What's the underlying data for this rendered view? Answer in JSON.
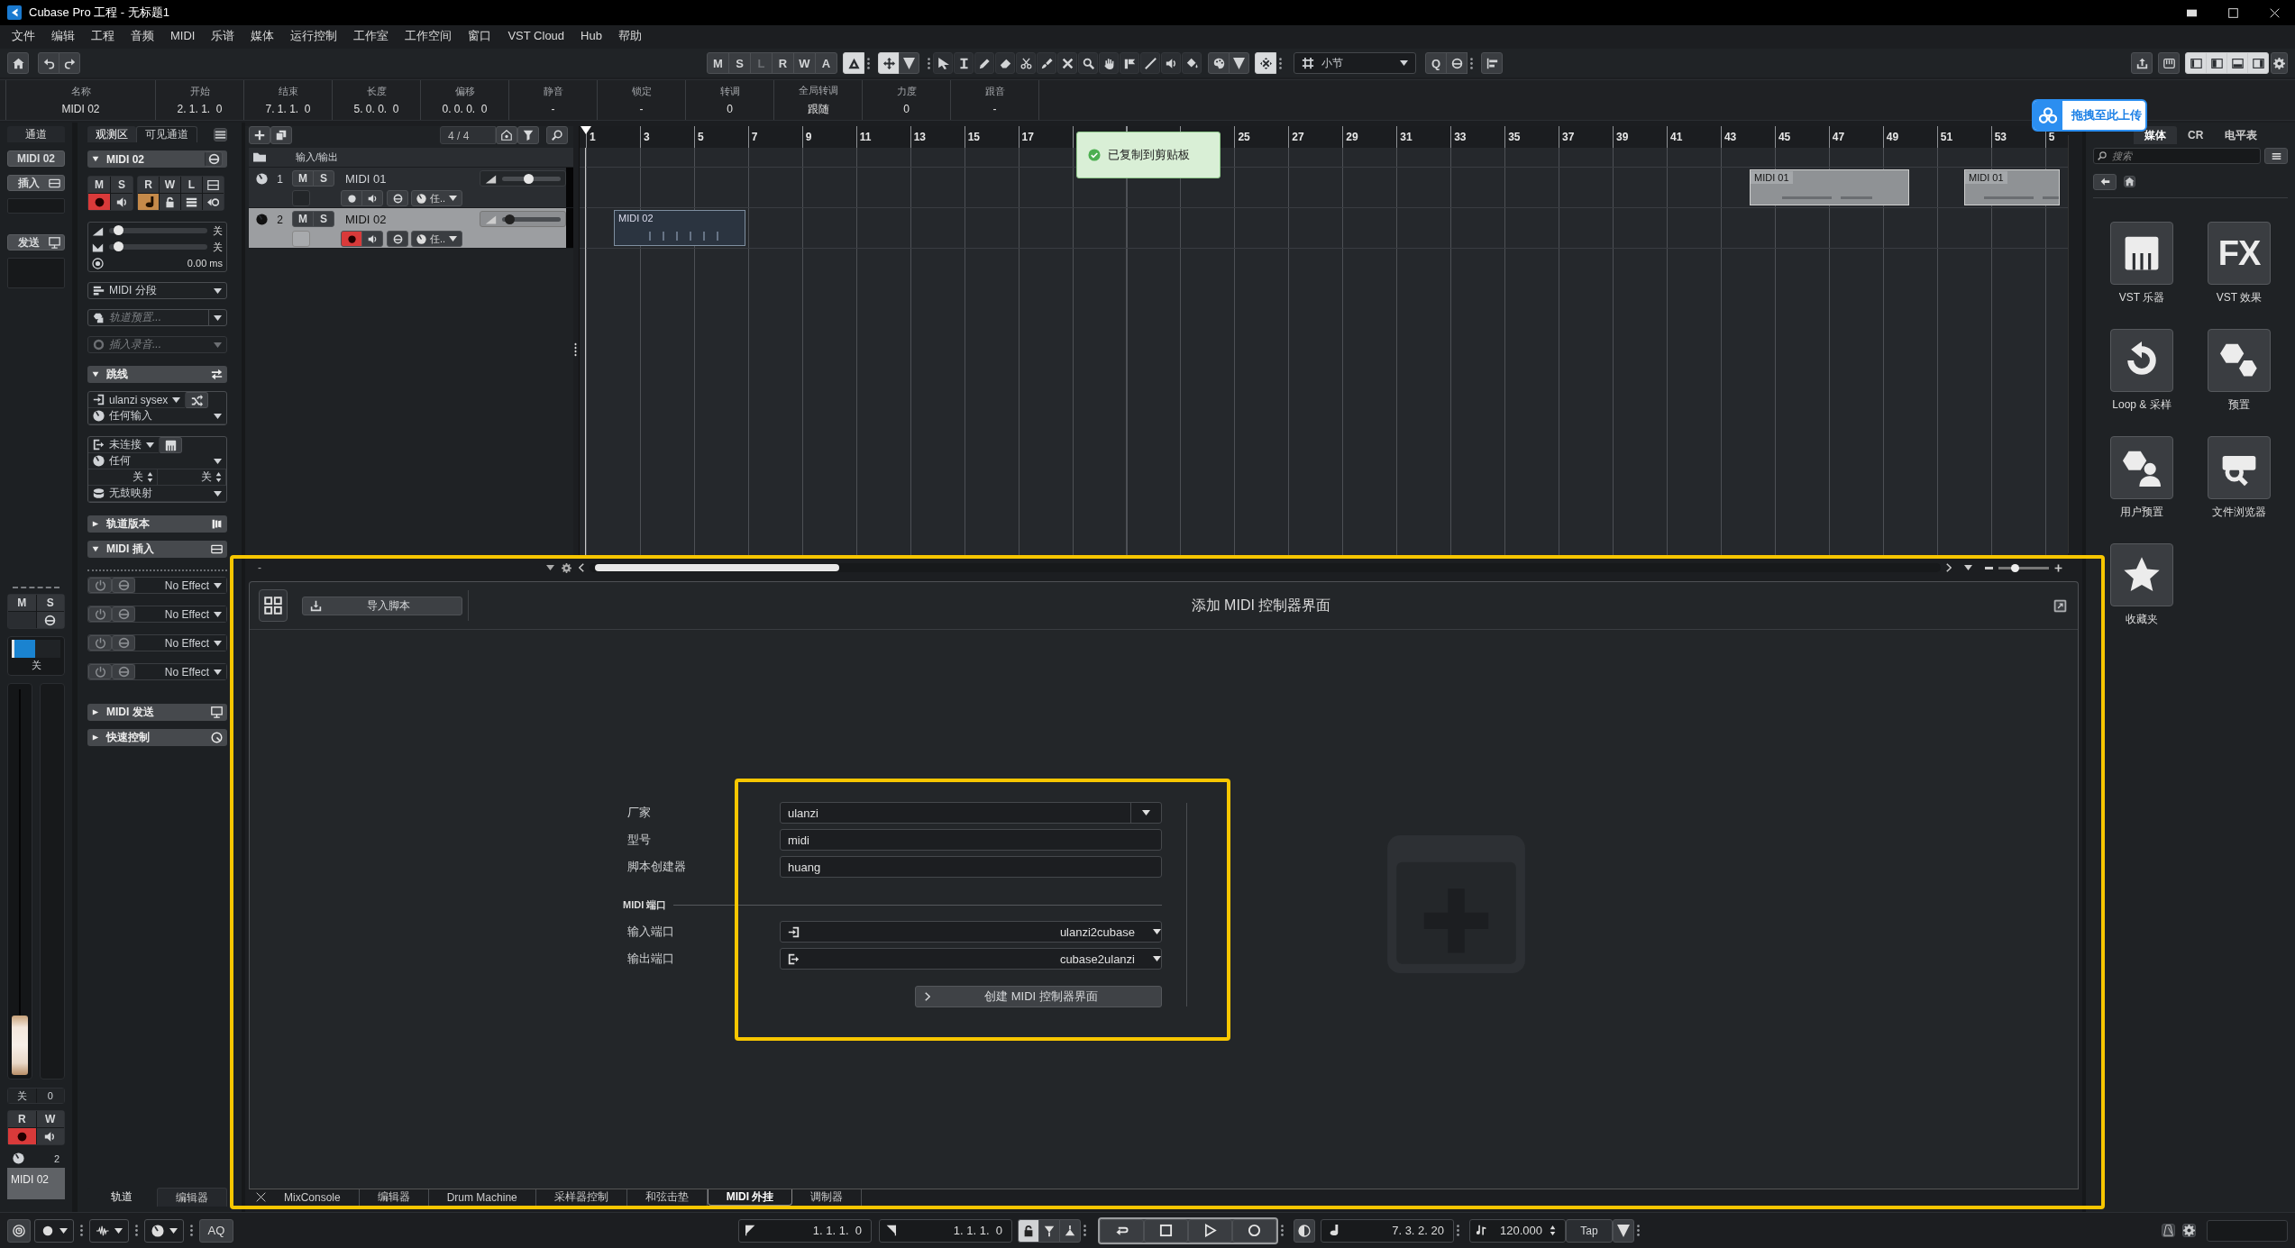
{
  "window": {
    "title": "Cubase Pro 工程 - 无标题1"
  },
  "menu": [
    "文件",
    "编辑",
    "工程",
    "音频",
    "MIDI",
    "乐谱",
    "媒体",
    "运行控制",
    "工作室",
    "工作空间",
    "窗口",
    "VST Cloud",
    "Hub",
    "帮助"
  ],
  "toolbar": {
    "automation": [
      {
        "label": "M",
        "disabled": false
      },
      {
        "label": "S",
        "disabled": false
      },
      {
        "label": "L",
        "disabled": true
      },
      {
        "label": "R",
        "disabled": false
      },
      {
        "label": "W",
        "disabled": false
      },
      {
        "label": "A",
        "disabled": false
      }
    ],
    "mode_toggles": [
      {
        "kind": "warp",
        "on": true
      },
      {
        "kind": "drag",
        "on": true
      }
    ],
    "snap": {
      "on": true
    },
    "grid_type": "小节",
    "quantize_label": "Q",
    "window_zones": [
      {
        "kind": "left",
        "on": true
      },
      {
        "kind": "inspector",
        "on": true
      },
      {
        "kind": "lower",
        "on": true
      },
      {
        "kind": "right",
        "on": true
      }
    ]
  },
  "info_line": [
    {
      "label": "名称",
      "value": "MIDI 02"
    },
    {
      "label": "开始",
      "value": "2. 1. 1.  0"
    },
    {
      "label": "结束",
      "value": "7. 1. 1.  0"
    },
    {
      "label": "长度",
      "value": "5. 0. 0.  0"
    },
    {
      "label": "偏移",
      "value": "0. 0. 0.  0"
    },
    {
      "label": "静音",
      "value": "-"
    },
    {
      "label": "锁定",
      "value": "-"
    },
    {
      "label": "转调",
      "value": "0"
    },
    {
      "label": "全局转调",
      "value": "跟随"
    },
    {
      "label": "力度",
      "value": "0"
    },
    {
      "label": "跟音",
      "value": "-"
    }
  ],
  "channel_strip": {
    "tab": "通道",
    "name_button": "MIDI 02",
    "insert_button": "插入",
    "send_button": "发送",
    "mute": "M",
    "solo": "S",
    "meter": {
      "level": 0.45,
      "reading": "关"
    },
    "fader": {
      "level": 0.01
    },
    "fader_readings": [
      "关",
      "0"
    ],
    "read": "R",
    "write": "W",
    "record": {
      "on": true
    },
    "monitor": {
      "on": false
    },
    "channel_number": "2",
    "name": "MIDI 02"
  },
  "inspector": {
    "tabs": [
      {
        "label": "观测区",
        "selected": true
      },
      {
        "label": "可见通道",
        "selected": false
      }
    ],
    "track_name": "MIDI 02",
    "letter_buttons": [
      "M",
      "S",
      "R",
      "W",
      "L"
    ],
    "toggles": [
      {
        "kind": "record",
        "on": true
      },
      {
        "kind": "monitor",
        "on": false
      },
      {
        "kind": "note",
        "on": true
      },
      {
        "kind": "lock",
        "on": false
      },
      {
        "kind": "lanes",
        "on": false
      },
      {
        "kind": "timebase",
        "on": false
      }
    ],
    "volume": {
      "level": 0.05,
      "reading": "关"
    },
    "pan": {
      "level": 0.05,
      "reading": "关"
    },
    "delay": "0.00 ms",
    "record_mode": "MIDI 分段",
    "track_preset": {
      "placeholder": "轨道预置..."
    },
    "insert_recording": {
      "label": "插入录音...",
      "disabled": true
    },
    "sections": [
      {
        "kind": "routing",
        "title": "跳线",
        "expanded": true,
        "input": "ulanzi sysex",
        "input_channel": "任何输入",
        "output": "未连接",
        "output_channel": "任何",
        "bank": "关",
        "program": "关",
        "drum_map": "无鼓映射"
      },
      {
        "kind": "versions",
        "title": "轨道版本",
        "expanded": false
      },
      {
        "kind": "inserts",
        "title": "MIDI 插入",
        "expanded": true,
        "slots": [
          "No Effect",
          "No Effect",
          "No Effect",
          "No Effect"
        ]
      },
      {
        "kind": "sends",
        "title": "MIDI 发送",
        "expanded": false
      },
      {
        "kind": "quick-controls",
        "title": "快速控制",
        "expanded": false
      }
    ]
  },
  "zone_tabs": [
    {
      "label": "轨道",
      "selected": true
    },
    {
      "label": "编辑器",
      "selected": false
    }
  ],
  "track_list": {
    "signature": "4 / 4",
    "folder": "输入/输出",
    "tracks": [
      {
        "number": "1",
        "name": "MIDI 01",
        "selected": false,
        "mute": "M",
        "solo": "S",
        "record": {
          "on": false
        },
        "volume": {
          "level": 0.45
        },
        "channel": "任..",
        "parts": [
          {
            "label": "MIDI 01",
            "selected": false
          },
          {
            "label": "MIDI 01",
            "selected": false
          }
        ]
      },
      {
        "number": "2",
        "name": "MIDI 02",
        "selected": true,
        "mute": "M",
        "solo": "S",
        "record": {
          "on": true
        },
        "volume": {
          "level": 0.05
        },
        "channel": "任..",
        "parts": [
          {
            "label": "MIDI 02",
            "selected": true
          }
        ]
      }
    ]
  },
  "ruler": [
    "1",
    "3",
    "5",
    "7",
    "9",
    "11",
    "13",
    "15",
    "17",
    "25",
    "27",
    "29",
    "31",
    "33",
    "35",
    "37",
    "39",
    "41",
    "43",
    "45",
    "47",
    "49",
    "51",
    "53",
    "5"
  ],
  "toast": "已复制到剪贴板",
  "upload_button": "拖拽至此上传",
  "media_bay": {
    "tabs": [
      {
        "label": "媒体",
        "selected": true
      },
      {
        "label": "CR",
        "selected": false
      },
      {
        "label": "电平表",
        "selected": false
      }
    ],
    "search": {
      "placeholder": "搜索"
    },
    "effects_glyph": "FX",
    "tiles": [
      {
        "kind": "instruments",
        "label": "VST 乐器"
      },
      {
        "kind": "effects",
        "label": "VST 效果"
      },
      {
        "kind": "loops",
        "label": "Loop & 采样"
      },
      {
        "kind": "presets",
        "label": "预置"
      },
      {
        "kind": "user-presets",
        "label": "用户预置"
      },
      {
        "kind": "browser",
        "label": "文件浏览器"
      },
      {
        "kind": "favorites",
        "label": "收藏夹"
      }
    ]
  },
  "lower_zone": {
    "header_label": "-",
    "zoom": {
      "level": 0.3
    },
    "editor": {
      "import_button": "导入脚本",
      "title": "添加 MIDI 控制器界面",
      "fields": [
        {
          "kind": "dropdown",
          "label": "厂家",
          "value": "ulanzi"
        },
        {
          "kind": "text",
          "label": "型号",
          "value": "midi"
        },
        {
          "kind": "text",
          "label": "脚本创建器",
          "value": "huang"
        },
        {
          "kind": "heading",
          "label": "MIDI 端口"
        },
        {
          "kind": "input-port",
          "label": "输入端口",
          "value": "ulanzi2cubase"
        },
        {
          "kind": "output-port",
          "label": "输出端口",
          "value": "cubase2ulanzi"
        }
      ],
      "create_button": "创建 MIDI 控制器界面"
    },
    "tabs": [
      {
        "label": "MixConsole",
        "selected": false
      },
      {
        "label": "编辑器",
        "selected": false
      },
      {
        "label": "Drum Machine",
        "selected": false
      },
      {
        "label": "采样器控制",
        "selected": false
      },
      {
        "label": "和弦击垫",
        "selected": false
      },
      {
        "label": "MIDI 外挂",
        "selected": true
      },
      {
        "label": "调制器",
        "selected": false
      }
    ]
  },
  "transport": {
    "left_locator": "1. 1. 1.  0",
    "right_locator": "1. 1. 1.  0",
    "position": "7. 3. 2. 20",
    "tempo": "120.000",
    "tap": "Tap",
    "auto_quantize": "AQ"
  }
}
